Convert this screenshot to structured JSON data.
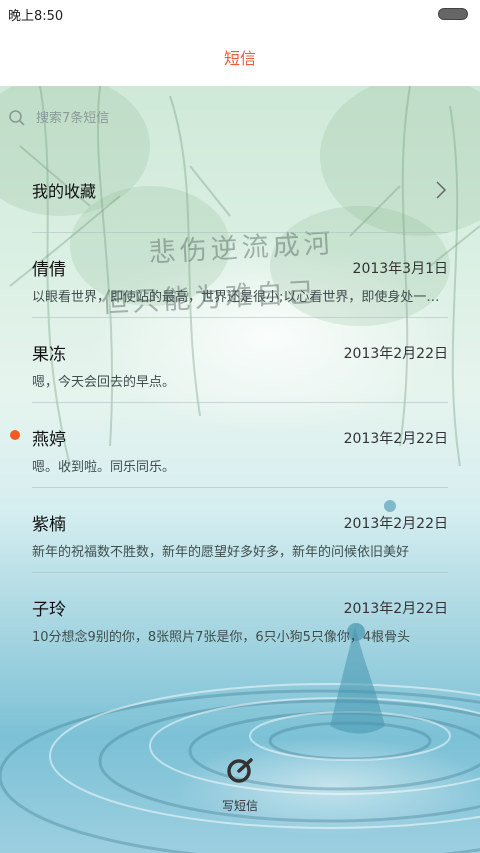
{
  "status_bar": {
    "time": "晚上8:50"
  },
  "header": {
    "title": "短信"
  },
  "search": {
    "placeholder": "搜索7条短信"
  },
  "favorites": {
    "label": "我的收藏"
  },
  "wallpaper_text": {
    "line1": "悲伤逆流成河",
    "line2": "但只能为难自己"
  },
  "conversations": [
    {
      "name": "倩倩",
      "date": "2013年3月1日",
      "preview": "以眼看世界，即使站的最高，世界还是很小;以心看世界，即使身处一隅，世界也是无限",
      "unread": false
    },
    {
      "name": "果冻",
      "date": "2013年2月22日",
      "preview": "嗯，今天会回去的早点。",
      "unread": false
    },
    {
      "name": "燕婷",
      "date": "2013年2月22日",
      "preview": "嗯。收到啦。同乐同乐。",
      "unread": true
    },
    {
      "name": "紫楠",
      "date": "2013年2月22日",
      "preview": "新年的祝福数不胜数，新年的愿望好多好多，新年的问候依旧美好",
      "unread": false
    },
    {
      "name": "子玲",
      "date": "2013年2月22日",
      "preview": "10分想念9别的你，8张照片7张是你，6只小狗5只像你，4根骨头",
      "unread": false
    }
  ],
  "compose": {
    "label": "写短信",
    "icon": "compose-icon"
  },
  "colors": {
    "accent": "#f05a3a",
    "unread": "#f35a22"
  }
}
